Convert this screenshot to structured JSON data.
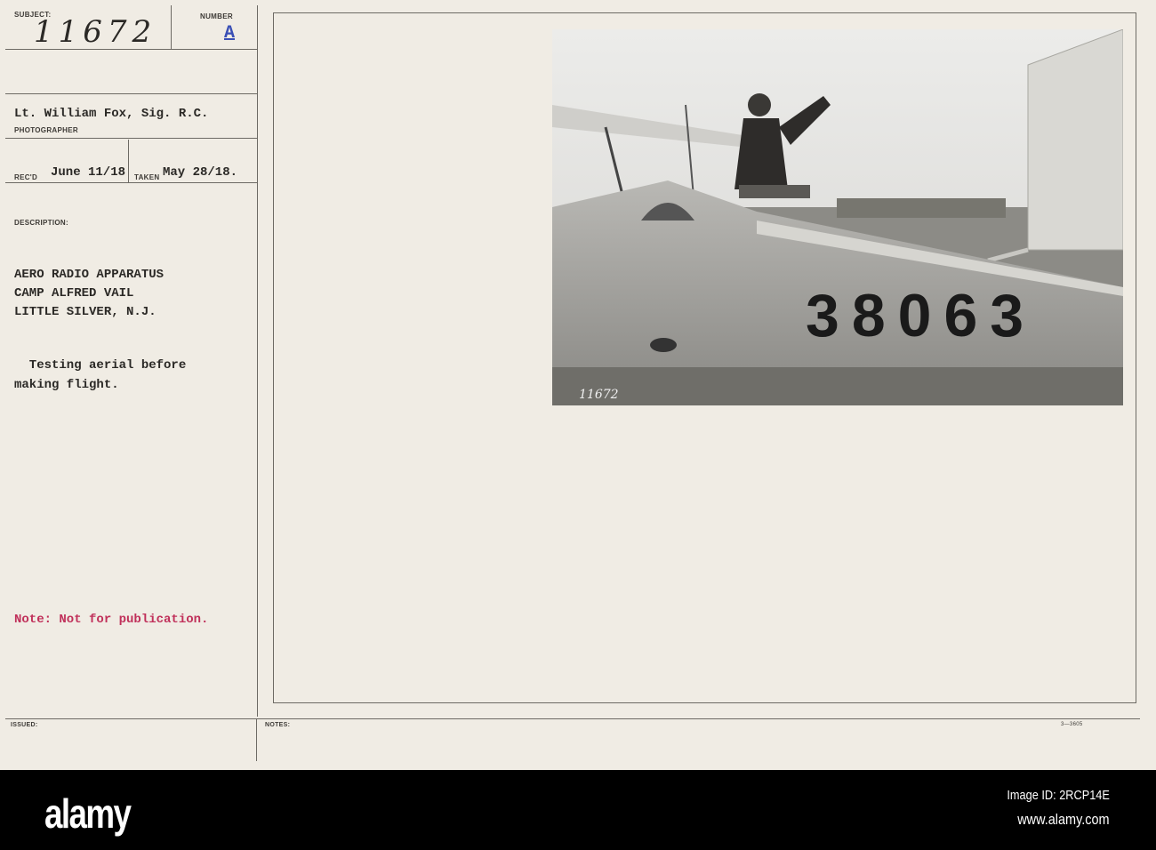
{
  "card": {
    "subject_label": "SUBJECT:",
    "subject_value": "11672",
    "number_label": "NUMBER",
    "number_value": "A",
    "photographer_value": "Lt. William Fox, Sig. R.C.",
    "photographer_label": "PHOTOGRAPHER",
    "recd_label": "REC'D",
    "recd_value": "June 11/18",
    "taken_label": "TAKEN",
    "taken_value": "May 28/18.",
    "description_label": "DESCRIPTION:",
    "description_lines": [
      "AERO RADIO APPARATUS",
      "CAMP ALFRED VAIL",
      "LITTLE SILVER, N.J."
    ],
    "caption_lines": [
      "  Testing aerial before",
      "making flight."
    ],
    "note": "Note: Not for publication.",
    "issued_label": "ISSUED:",
    "notes_label": "NOTES:",
    "form_number": "3—3605"
  },
  "photo": {
    "plane_number": "38063",
    "negative_number": "11672"
  },
  "footer": {
    "logo": "alamy",
    "image_id": "Image ID: 2RCP14E",
    "url": "www.alamy.com"
  },
  "colors": {
    "paper": "#f0ece4",
    "ink": "#2b2926",
    "note_red": "#c0305a",
    "number_blue": "#3a4fb5"
  }
}
